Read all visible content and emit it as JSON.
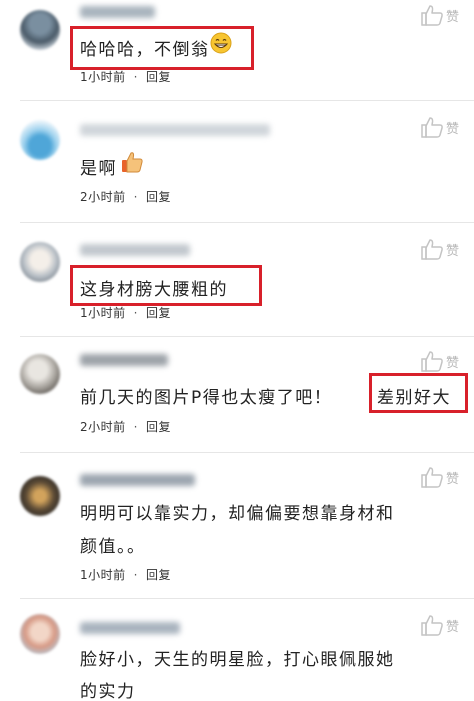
{
  "like_label": "赞",
  "comments": [
    {
      "text": "哈哈哈，不倒翁",
      "emoji": "grinning-face-icon",
      "time": "1小时前",
      "separator": "·",
      "reply": "回复"
    },
    {
      "text": "是啊",
      "emoji": "thumbs-up-icon",
      "time": "2小时前",
      "separator": "·",
      "reply": "回复"
    },
    {
      "text": "这身材膀大腰粗的",
      "time": "1小时前",
      "separator": "·",
      "reply": "回复"
    },
    {
      "text": "前几天的图片P得也太瘦了吧！",
      "highlight": "差别好大",
      "time": "2小时前",
      "separator": "·",
      "reply": "回复"
    },
    {
      "text_lines": [
        "明明可以靠实力，却偏偏要想靠身材和",
        "颜值。。"
      ],
      "time": "1小时前",
      "separator": "·",
      "reply": "回复"
    },
    {
      "text_lines": [
        "脸好小，天生的明星脸，打心眼佩服她",
        "的实力"
      ]
    }
  ],
  "colors": {
    "highlight_box": "#d8202a",
    "text": "#222222",
    "meta": "#333333",
    "like_icon": "#c4c4c4",
    "divider": "#e6e6e6"
  }
}
